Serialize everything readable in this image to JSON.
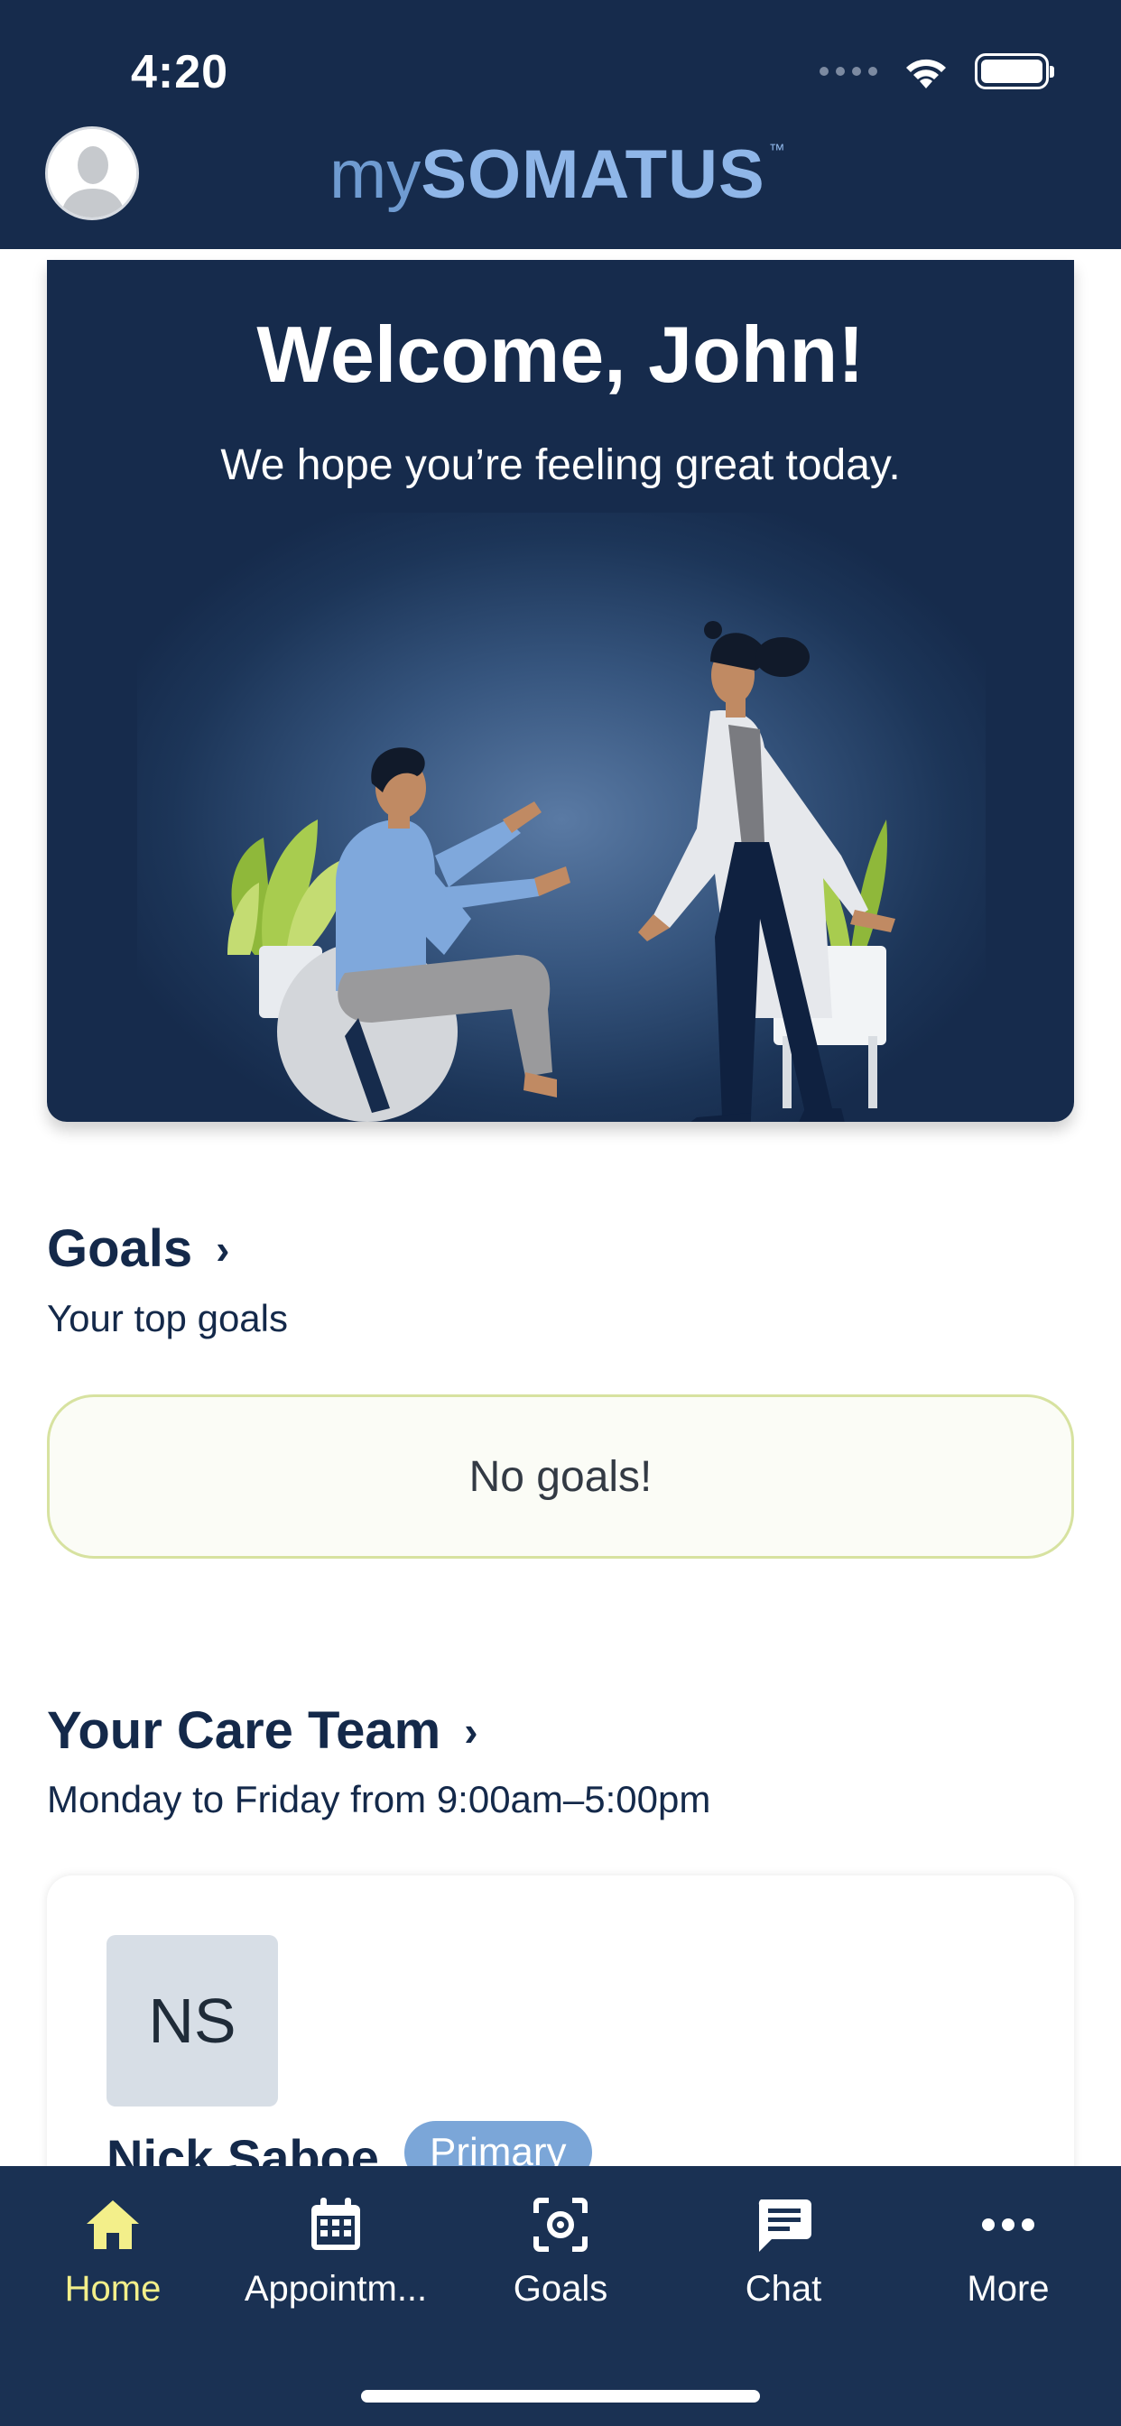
{
  "status_bar": {
    "time": "4:20"
  },
  "header": {
    "logo_my": "my",
    "logo_somatus": "SOMATUS",
    "logo_tm": "™"
  },
  "welcome": {
    "title": "Welcome, John!",
    "subtitle": "We hope you’re feeling great today."
  },
  "goals": {
    "title": "Goals",
    "subtitle": "Your top goals",
    "empty_text": "No goals!"
  },
  "care_team": {
    "title": "Your Care Team",
    "hours": "Monday to Friday from 9:00am–5:00pm",
    "member": {
      "initials": "NS",
      "name": "Nick Saboe",
      "badge": "Primary"
    }
  },
  "bottom_nav": {
    "items": [
      {
        "label": "Home",
        "icon": "home-icon"
      },
      {
        "label": "Appointm...",
        "icon": "calendar-icon"
      },
      {
        "label": "Goals",
        "icon": "target-icon"
      },
      {
        "label": "Chat",
        "icon": "chat-icon"
      },
      {
        "label": "More",
        "icon": "more-icon"
      }
    ]
  },
  "colors": {
    "brand_navy": "#162b4c",
    "nav_active": "#f3ef8a",
    "badge_blue": "#7ba6d8",
    "goal_border": "#d7e2a0"
  }
}
